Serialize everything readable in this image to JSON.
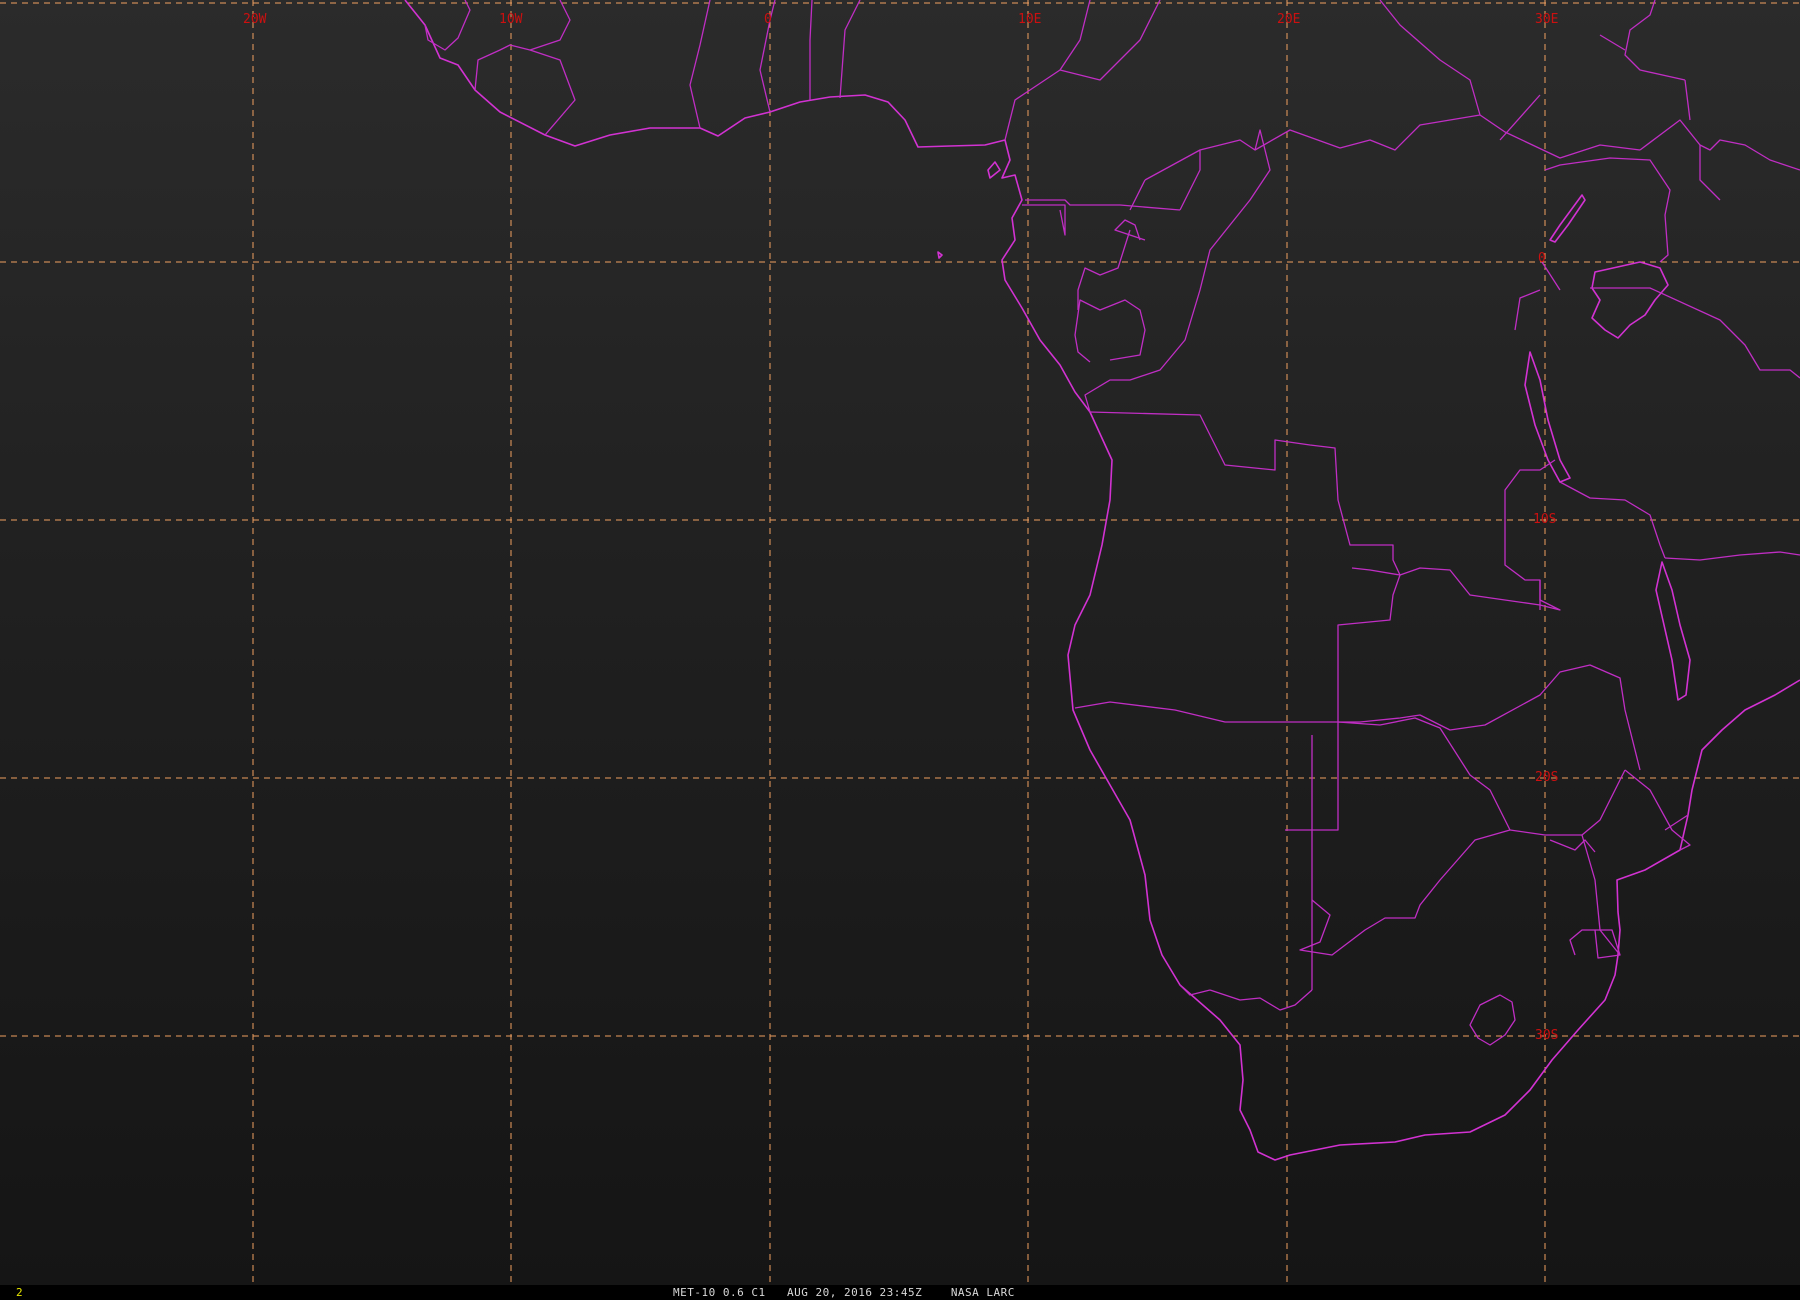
{
  "frame_number": "2",
  "caption": {
    "satellite_channel": "MET-10 0.6 C1",
    "datetime": "AUG 20, 2016 23:45Z",
    "source": "NASA LARC"
  },
  "grid": {
    "longitude_labels": [
      "20W",
      "10W",
      "0",
      "10E",
      "20E",
      "30E"
    ],
    "latitude_labels": [
      "0",
      "10S",
      "20S",
      "30S"
    ]
  },
  "colors": {
    "background": "#1e1e1e",
    "gridlines": "#f0a060",
    "grid_labels": "#cc1010",
    "coastlines_borders": "#d232d2",
    "frame_number": "#e6e600"
  }
}
